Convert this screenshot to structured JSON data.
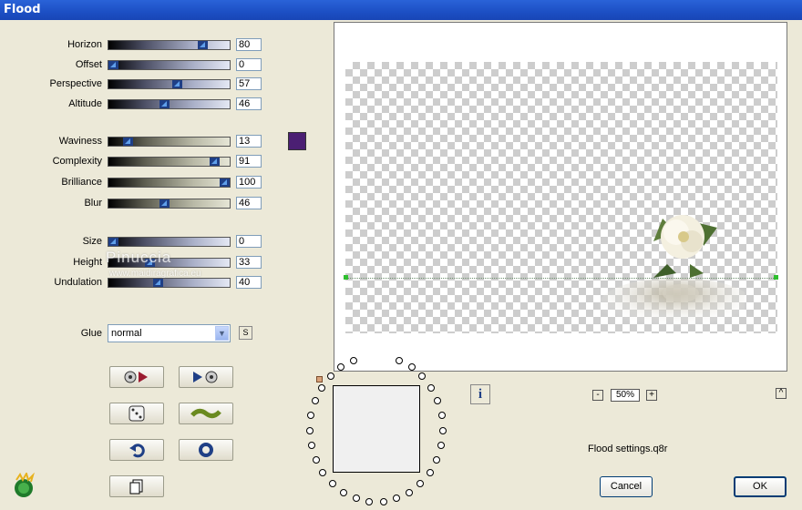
{
  "window": {
    "title": "Flood"
  },
  "controls": [
    {
      "label": "Horizon",
      "value": "80",
      "fraction": 0.8,
      "style": "blue"
    },
    {
      "label": "Offset",
      "value": "0",
      "fraction": 0.0,
      "style": "blue"
    },
    {
      "label": "Perspective",
      "value": "57",
      "fraction": 0.57,
      "style": "blue"
    },
    {
      "label": "Altitude",
      "value": "46",
      "fraction": 0.46,
      "style": "blue"
    },
    {
      "label": "Waviness",
      "value": "13",
      "fraction": 0.13,
      "style": "gray"
    },
    {
      "label": "Complexity",
      "value": "91",
      "fraction": 0.91,
      "style": "gray"
    },
    {
      "label": "Brilliance",
      "value": "100",
      "fraction": 1.0,
      "style": "gray"
    },
    {
      "label": "Blur",
      "value": "46",
      "fraction": 0.46,
      "style": "gray"
    },
    {
      "label": "Size",
      "value": "0",
      "fraction": 0.0,
      "style": "blue"
    },
    {
      "label": "Height",
      "value": "33",
      "fraction": 0.33,
      "style": "blue"
    },
    {
      "label": "Undulation",
      "value": "40",
      "fraction": 0.4,
      "style": "blue"
    }
  ],
  "color_swatch": "#4b1f73",
  "glue": {
    "label": "Glue",
    "value": "normal",
    "s_button": "S"
  },
  "watermark": {
    "line1": "Pinuccia",
    "line2": "www.maidiragrafica.eu"
  },
  "zoom": {
    "level": "50%",
    "minus": "-",
    "plus": "+"
  },
  "status_text": "Flood settings.q8r",
  "info_button": "i",
  "scroll_up": "^",
  "buttons": {
    "cancel": "Cancel",
    "ok": "OK"
  },
  "icons": [
    "play-reverse-icon",
    "play-forward-icon",
    "dice-icon",
    "wave-icon",
    "undo-icon",
    "reset-icon",
    "copy-icon",
    "logo-icon",
    "info-icon",
    "chevron-down-icon"
  ]
}
